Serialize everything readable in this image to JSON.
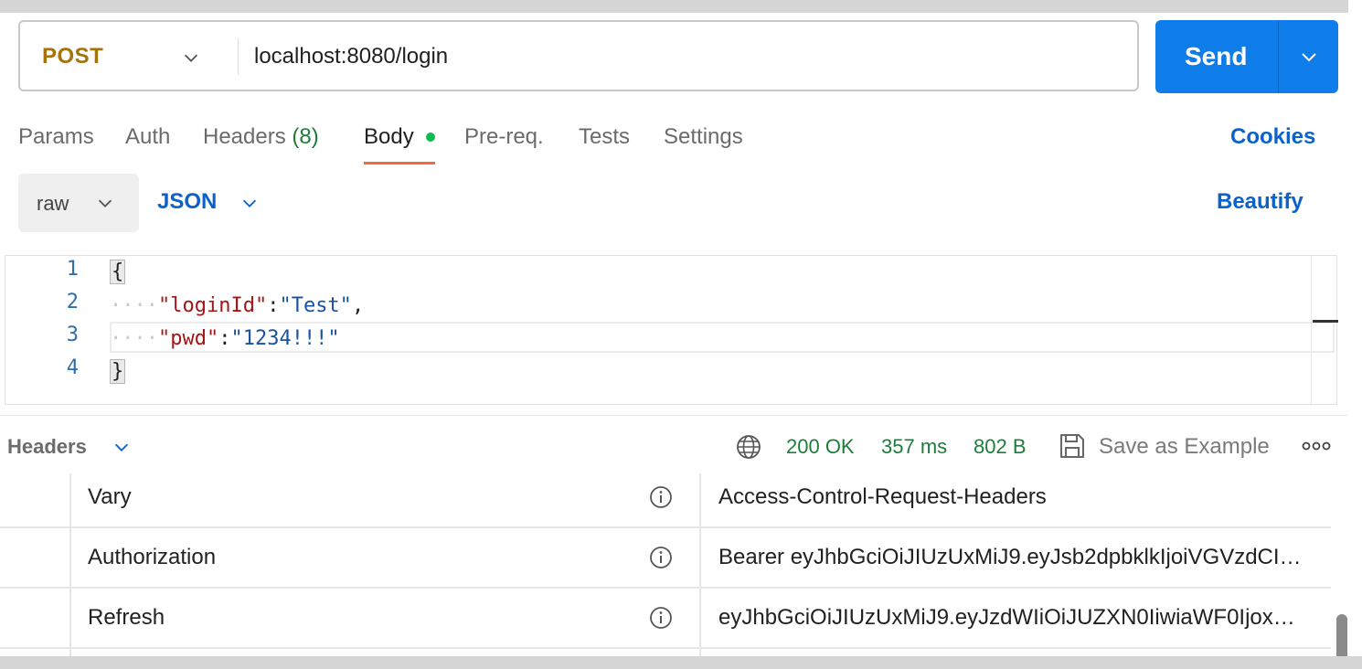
{
  "request": {
    "method": "POST",
    "url": "localhost:8080/login",
    "send_label": "Send"
  },
  "tabs": [
    {
      "label": "Params"
    },
    {
      "label": "Auth"
    },
    {
      "label": "Headers",
      "count": "(8)"
    },
    {
      "label": "Body"
    },
    {
      "label": "Pre-req."
    },
    {
      "label": "Tests"
    },
    {
      "label": "Settings"
    }
  ],
  "cookies_label": "Cookies",
  "body": {
    "mode": "raw",
    "language": "JSON",
    "beautify_label": "Beautify",
    "line_numbers": [
      "1",
      "2",
      "3",
      "4"
    ],
    "lines": [
      {
        "open": "{"
      },
      {
        "indent": "····",
        "key": "\"loginId\"",
        "sep": ":",
        "value": "\"Test\"",
        "trail": ","
      },
      {
        "indent": "····",
        "key": "\"pwd\"",
        "sep": ":",
        "value": "\"1234!!!\"",
        "trail": ""
      },
      {
        "close": "}"
      }
    ]
  },
  "response": {
    "section_label": "Headers",
    "status": "200 OK",
    "time": "357 ms",
    "size": "802 B",
    "save_label": "Save as Example",
    "headers": [
      {
        "key": "Vary",
        "value": "Access-Control-Request-Headers"
      },
      {
        "key": "Authorization",
        "value": "Bearer eyJhbGciOiJIUzUxMiJ9.eyJsb2dpbklkIjoiVGVzdCI…"
      },
      {
        "key": "Refresh",
        "value": "eyJhbGciOiJIUzUxMiJ9.eyJzdWIiOiJUZXN0IiwiaWF0Ijox…"
      }
    ]
  },
  "colors": {
    "send_bg": "#0f7de9",
    "method": "#a6730a",
    "link": "#0b62c9",
    "status_ok": "#1d7d3a",
    "tab_active_underline": "#f26b3a",
    "body_dot": "#0cbb52"
  }
}
